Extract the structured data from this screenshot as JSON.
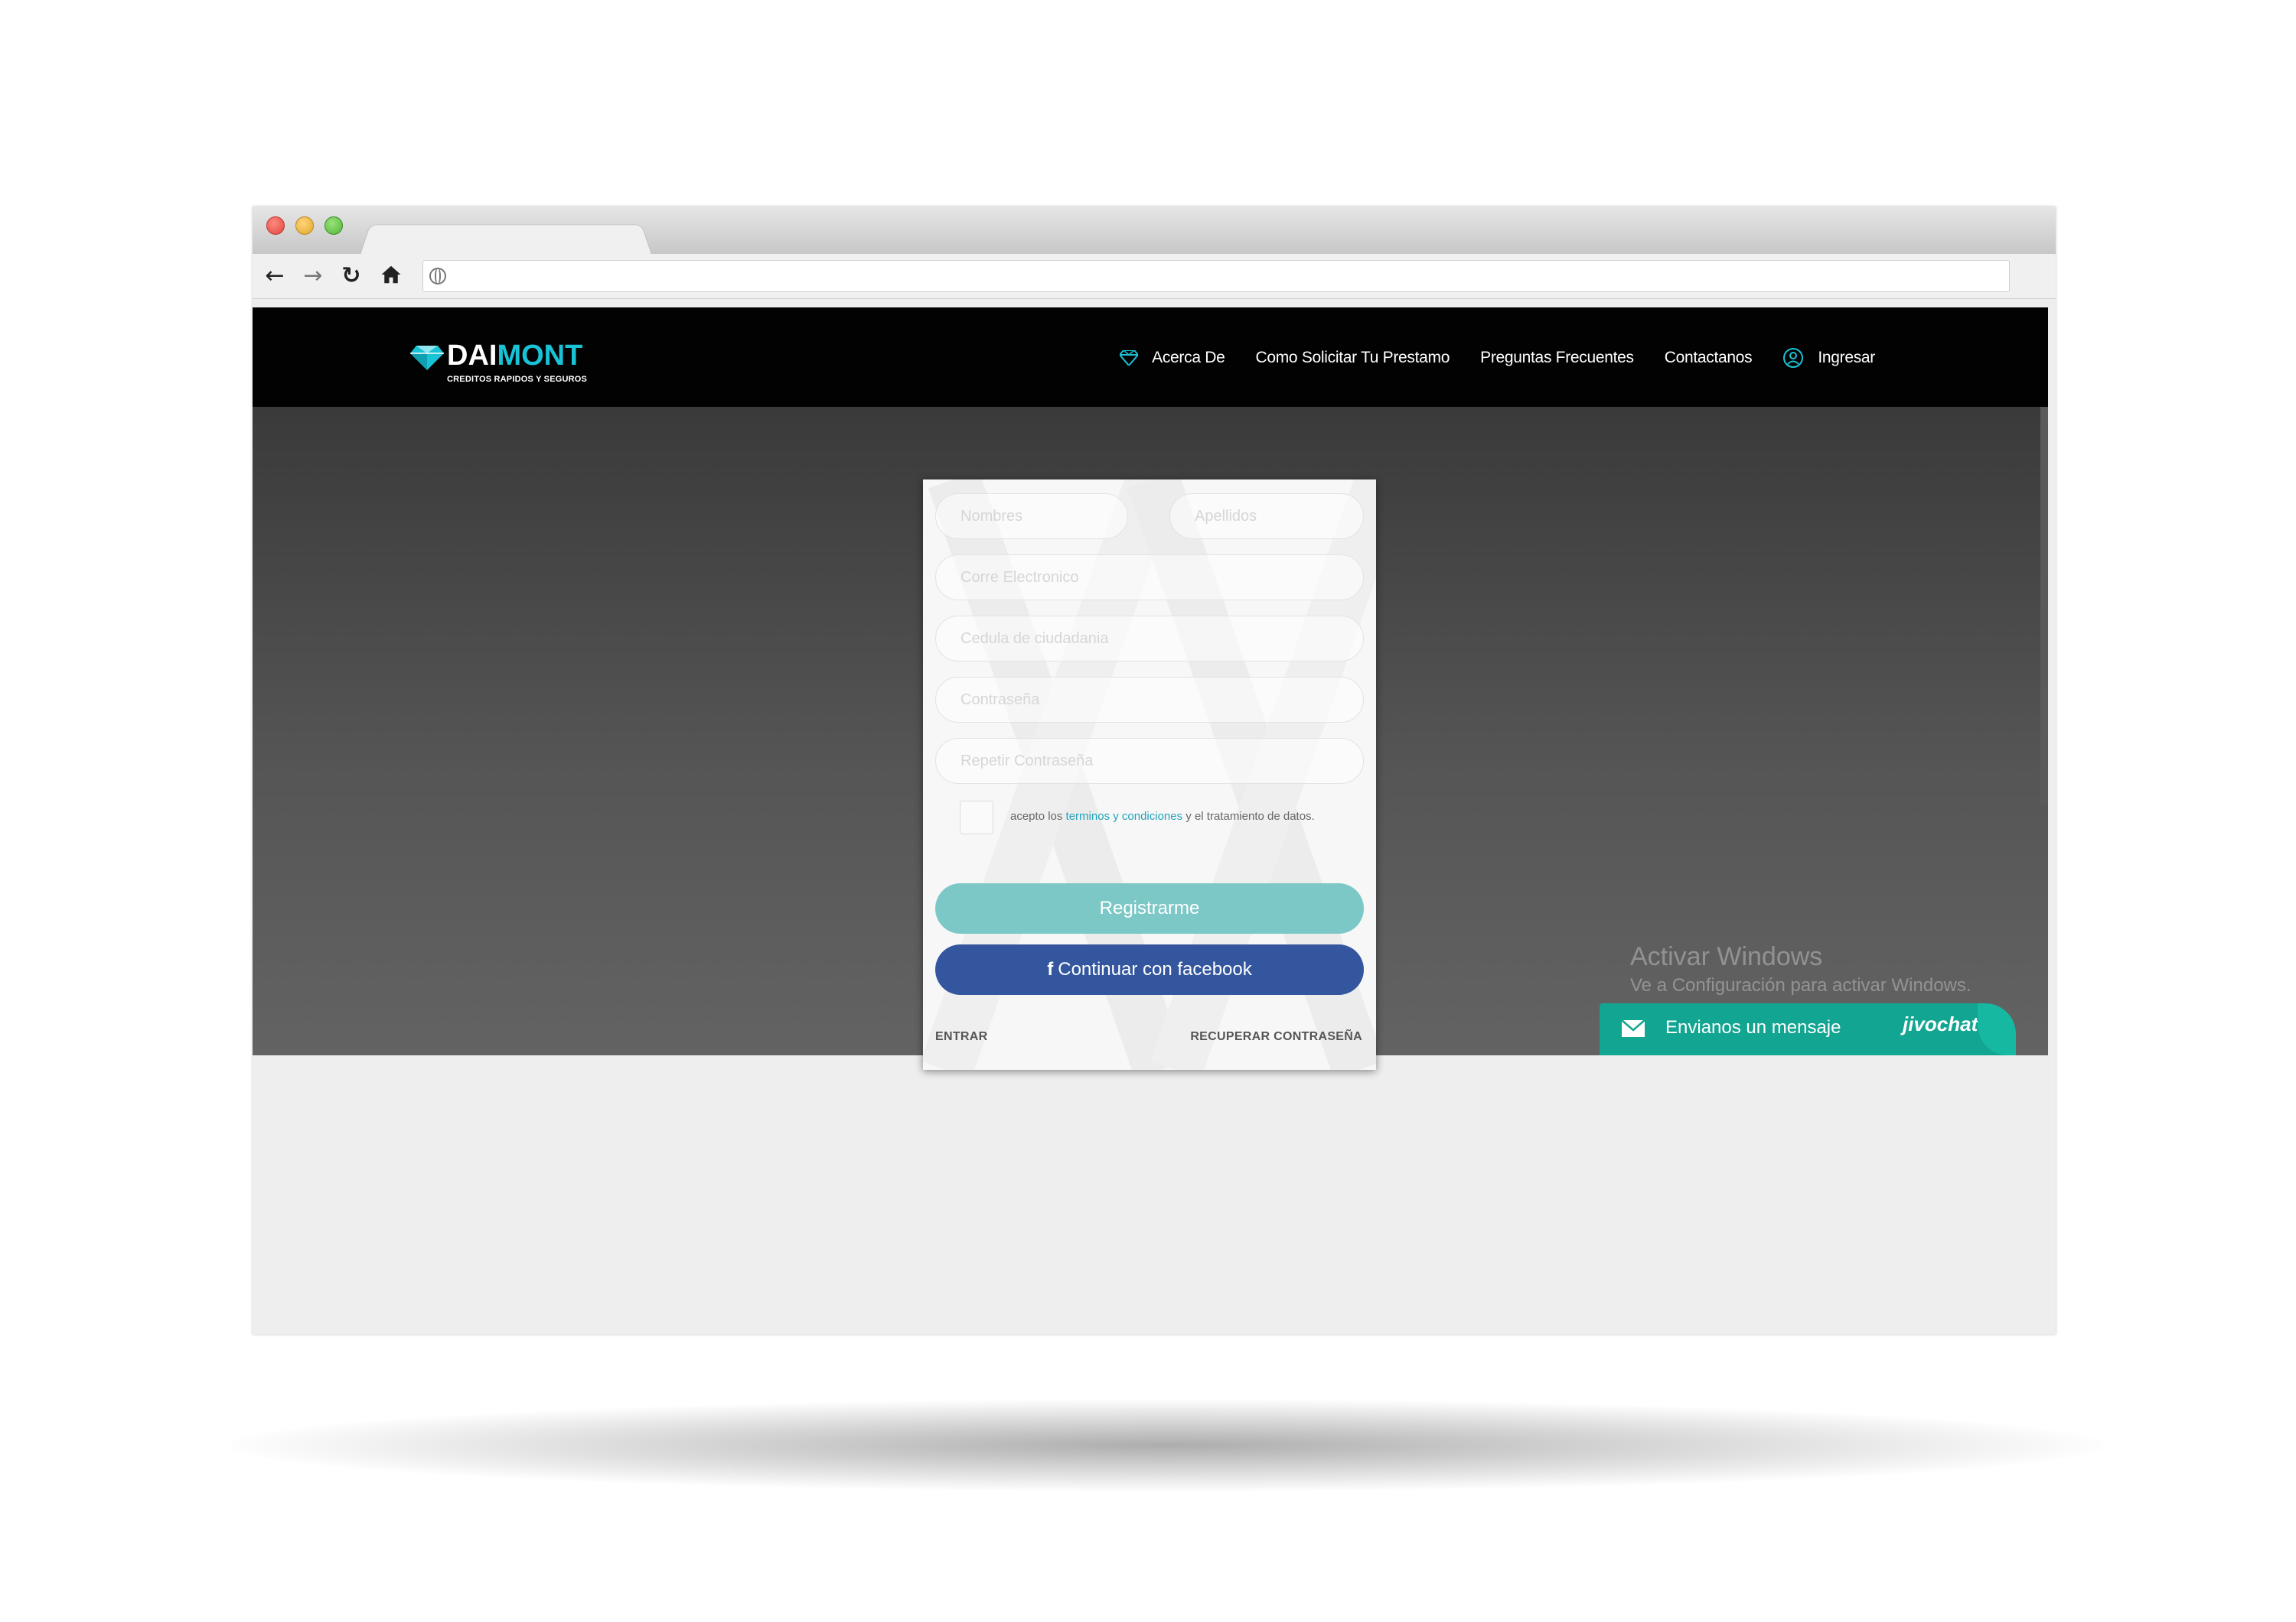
{
  "browser": {
    "url": ""
  },
  "site": {
    "logo": {
      "part1": "DAI",
      "part2": "MONT",
      "tagline": "CREDITOS RAPIDOS Y SEGUROS"
    },
    "nav": [
      {
        "label": "Acerca De",
        "icon": "diamond-icon"
      },
      {
        "label": "Como Solicitar Tu Prestamo"
      },
      {
        "label": "Preguntas Frecuentes"
      },
      {
        "label": "Contactanos"
      },
      {
        "label": "Ingresar",
        "icon": "user-circle-icon"
      }
    ],
    "accent_color": "#19c3d6"
  },
  "form": {
    "nombres_placeholder": "Nombres",
    "apellidos_placeholder": "Apellidos",
    "email_placeholder": "Corre Electronico",
    "cedula_placeholder": "Cedula de ciudadania",
    "password_placeholder": "Contraseña",
    "repeat_password_placeholder": "Repetir Contraseña",
    "terms_prefix": "acepto los ",
    "terms_link": "terminos y condiciones",
    "terms_suffix": " y el tratamiento de datos.",
    "register_label": "Registrarme",
    "facebook_icon": "f",
    "facebook_label": "Continuar con facebook",
    "login_link": "ENTRAR",
    "recover_link": "RECUPERAR CONTRASEÑA",
    "register_color": "#7cc8c7",
    "facebook_color": "#33569e"
  },
  "watermark": {
    "title": "Activar Windows",
    "subtitle": "Ve a Configuración para activar Windows."
  },
  "chat": {
    "label": "Envianos un mensaje",
    "brand": "jivochat",
    "color": "#12a591"
  }
}
